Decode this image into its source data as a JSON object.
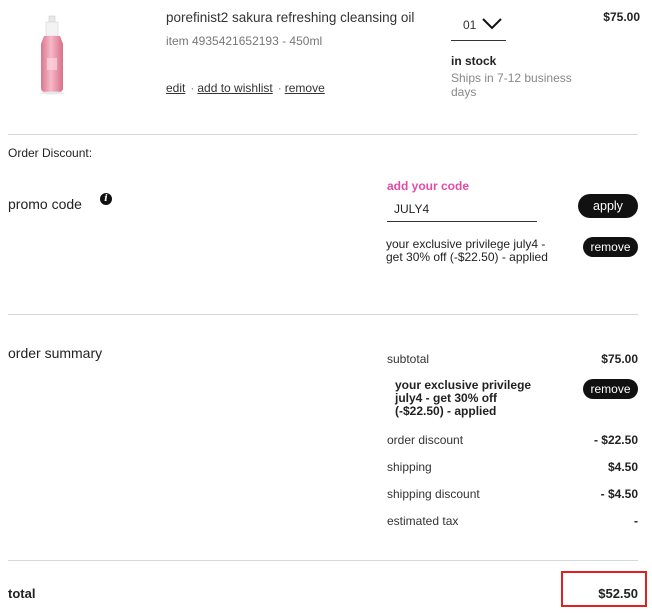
{
  "product": {
    "name": "porefinist2 sakura refreshing cleansing oil",
    "item_line": "item 4935421652193 - 450ml",
    "actions": [
      "edit",
      "add to wishlist",
      "remove"
    ],
    "quantity": "01",
    "stock": "in stock",
    "shipping_note": "Ships in 7-12 business days",
    "price": "$75.00",
    "image_icon": "pink-cleansing-oil-bottle"
  },
  "order_discount": {
    "label": "Order Discount:"
  },
  "promo": {
    "title": "promo code",
    "info_icon": "info-icon",
    "add_code_label": "add your code",
    "code_value": "JULY4",
    "apply_label": "apply",
    "applied_text": "your exclusive privilege july4 - get 30% off (-$22.50) - applied",
    "remove_label": "remove"
  },
  "summary": {
    "title": "order summary",
    "subtotal_label": "subtotal",
    "subtotal_value": "$75.00",
    "privilege_text": "your exclusive privilege july4 - get 30% off (-$22.50) - applied",
    "remove_label": "remove",
    "order_discount_label": "order discount",
    "order_discount_value": "- $22.50",
    "shipping_label": "shipping",
    "shipping_value": "$4.50",
    "shipping_discount_label": "shipping discount",
    "shipping_discount_value": "- $4.50",
    "tax_label": "estimated tax",
    "tax_value": "-",
    "total_label": "total",
    "total_value": "$52.50"
  },
  "colors": {
    "accent_pink": "#e44aa8",
    "highlight_red": "#e02020",
    "button_black": "#111111"
  }
}
